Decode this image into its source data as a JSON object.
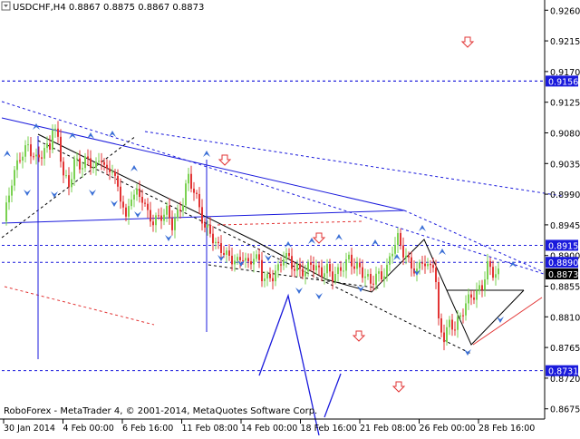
{
  "chart_title": "USDCHF,H4  0.8867 0.8875 0.8867 0.8873",
  "copyright": "RoboForex - MetaTrader 4, © 2001-2014, MetaQuotes Software Corp.",
  "colors": {
    "background": "#ffffff",
    "bull_candle": "#7ad151",
    "bear_candle": "#e23434",
    "trendline_blue": "#1a1adc",
    "wave_black": "#000000",
    "support_red": "#e23434",
    "arrow_blue": "#3a6fd6",
    "arrow_red": "#e23434",
    "level_label_bg": "#1a1adc",
    "price_label_bg": "#000000",
    "label_text": "#ffffff"
  },
  "chart_data": {
    "type": "candlestick",
    "symbol": "USDCHF",
    "timeframe": "H4",
    "ohlc_header": {
      "open": 0.8867,
      "high": 0.8875,
      "low": 0.8867,
      "close": 0.8873
    },
    "y_range": [
      0.866,
      0.9275
    ],
    "y_ticks": [
      "0.9260",
      "0.9215",
      "0.9170",
      "0.9125",
      "0.9080",
      "0.9035",
      "0.8990",
      "0.8945",
      "0.8900",
      "0.8855",
      "0.8810",
      "0.8765",
      "0.8720",
      "0.8675"
    ],
    "x_ticks": [
      "30 Jan 2014",
      "4 Feb 00:00",
      "6 Feb 16:00",
      "11 Feb 08:00",
      "14 Feb 00:00",
      "18 Feb 16:00",
      "21 Feb 08:00",
      "26 Feb 00:00",
      "28 Feb 16:00"
    ],
    "horizontal_levels": [
      {
        "label": "0.9156",
        "value": 0.9156,
        "style": "dashed-blue"
      },
      {
        "label": "0.8915",
        "value": 0.8915,
        "style": "dashed-blue"
      },
      {
        "label": "0.8890",
        "value": 0.889,
        "style": "dashed-blue"
      },
      {
        "label": "0.8731",
        "value": 0.8731,
        "style": "dashed-blue"
      }
    ],
    "current_price": {
      "label": "0.8873",
      "value": 0.8873
    },
    "close_path": [
      [
        0,
        0.895
      ],
      [
        3,
        0.901
      ],
      [
        6,
        0.9045
      ],
      [
        9,
        0.906
      ],
      [
        12,
        0.904
      ],
      [
        15,
        0.9055
      ],
      [
        17,
        0.906
      ],
      [
        18,
        0.909
      ],
      [
        20,
        0.907
      ],
      [
        22,
        0.902
      ],
      [
        24,
        0.9
      ],
      [
        26,
        0.904
      ],
      [
        28,
        0.903
      ],
      [
        30,
        0.904
      ],
      [
        32,
        0.9035
      ],
      [
        34,
        0.903
      ],
      [
        36,
        0.9045
      ],
      [
        38,
        0.902
      ],
      [
        40,
        0.903
      ],
      [
        42,
        0.8995
      ],
      [
        44,
        0.8975
      ],
      [
        45,
        0.895
      ],
      [
        47,
        0.899
      ],
      [
        49,
        0.899
      ],
      [
        51,
        0.8985
      ],
      [
        53,
        0.896
      ],
      [
        55,
        0.895
      ],
      [
        57,
        0.8955
      ],
      [
        60,
        0.8965
      ],
      [
        62,
        0.8945
      ],
      [
        64,
        0.896
      ],
      [
        66,
        0.898
      ],
      [
        67,
        0.9
      ],
      [
        68,
        0.9015
      ],
      [
        70,
        0.8995
      ],
      [
        72,
        0.897
      ],
      [
        74,
        0.894
      ],
      [
        76,
        0.8935
      ],
      [
        78,
        0.8915
      ],
      [
        80,
        0.891
      ],
      [
        82,
        0.89
      ],
      [
        84,
        0.8895
      ],
      [
        86,
        0.889
      ],
      [
        88,
        0.89
      ],
      [
        90,
        0.8885
      ],
      [
        92,
        0.89
      ],
      [
        94,
        0.889
      ],
      [
        95,
        0.887
      ],
      [
        97,
        0.8865
      ],
      [
        99,
        0.887
      ],
      [
        101,
        0.888
      ],
      [
        103,
        0.89
      ],
      [
        105,
        0.8895
      ],
      [
        107,
        0.888
      ],
      [
        109,
        0.888
      ],
      [
        111,
        0.8875
      ],
      [
        113,
        0.889
      ],
      [
        115,
        0.888
      ],
      [
        117,
        0.8875
      ],
      [
        119,
        0.888
      ],
      [
        121,
        0.887
      ],
      [
        123,
        0.8875
      ],
      [
        125,
        0.8885
      ],
      [
        127,
        0.8895
      ],
      [
        129,
        0.8885
      ],
      [
        131,
        0.888
      ],
      [
        133,
        0.887
      ],
      [
        135,
        0.886
      ],
      [
        137,
        0.887
      ],
      [
        139,
        0.887
      ],
      [
        141,
        0.888
      ],
      [
        143,
        0.891
      ],
      [
        145,
        0.8925
      ],
      [
        147,
        0.8905
      ],
      [
        149,
        0.889
      ],
      [
        151,
        0.888
      ],
      [
        152,
        0.8875
      ],
      [
        154,
        0.8895
      ],
      [
        156,
        0.888
      ],
      [
        158,
        0.889
      ],
      [
        159,
        0.886
      ],
      [
        160,
        0.88
      ],
      [
        161,
        0.879
      ],
      [
        162,
        0.878
      ],
      [
        163,
        0.879
      ],
      [
        164,
        0.88
      ],
      [
        166,
        0.8795
      ],
      [
        168,
        0.881
      ],
      [
        170,
        0.883
      ],
      [
        172,
        0.884
      ],
      [
        174,
        0.8845
      ],
      [
        176,
        0.8855
      ],
      [
        177,
        0.887
      ],
      [
        178,
        0.8885
      ],
      [
        180,
        0.8875
      ],
      [
        182,
        0.8873
      ]
    ]
  }
}
